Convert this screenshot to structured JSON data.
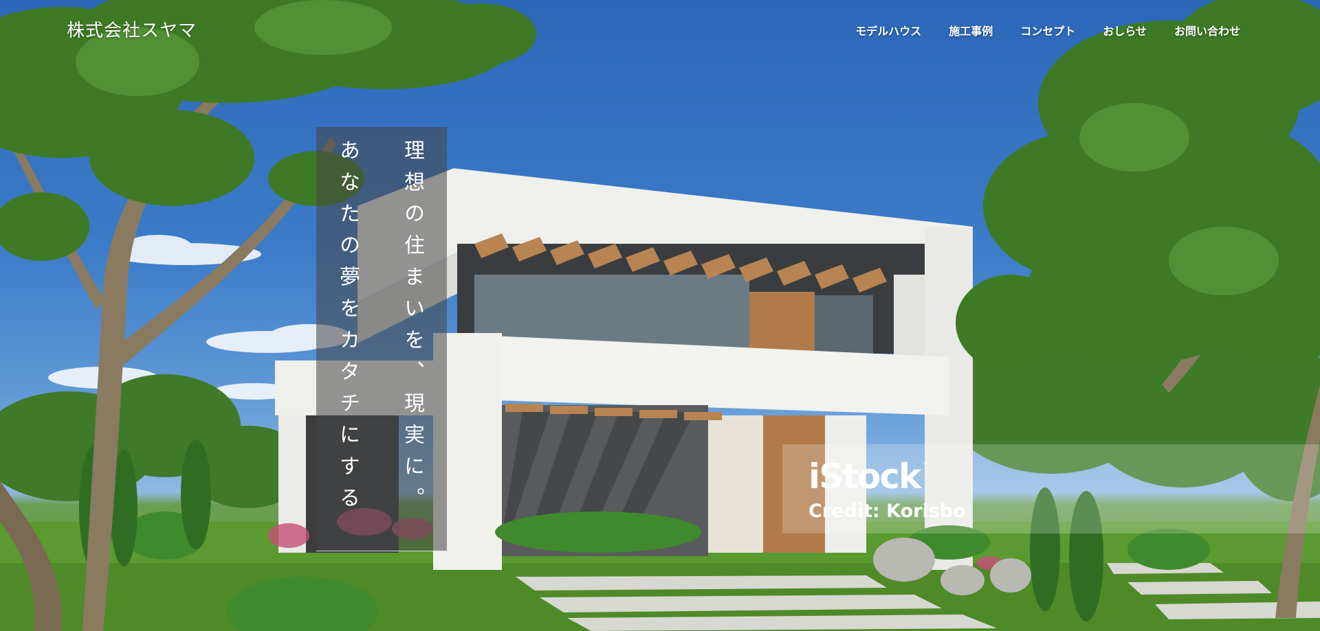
{
  "header": {
    "logo": "株式会社スヤマ",
    "nav": [
      {
        "label": "モデルハウス"
      },
      {
        "label": "施工事例"
      },
      {
        "label": "コンセプト"
      },
      {
        "label": "おしらせ"
      },
      {
        "label": "お問い合わせ"
      }
    ]
  },
  "hero": {
    "catch_line_1": "理想の住まいを、現実に。",
    "catch_line_2": "あなたの夢をカタチにする",
    "image_subject": "modern two-story white house with wooden pergola, trees and lawn"
  },
  "watermark": {
    "brand": "iStock",
    "tm": "™",
    "credit": "Credit: Korisbo"
  },
  "colors": {
    "sky": "#3c7cc8",
    "lawn": "#5a9236",
    "overlay": "#464646",
    "text": "#ffffff"
  }
}
